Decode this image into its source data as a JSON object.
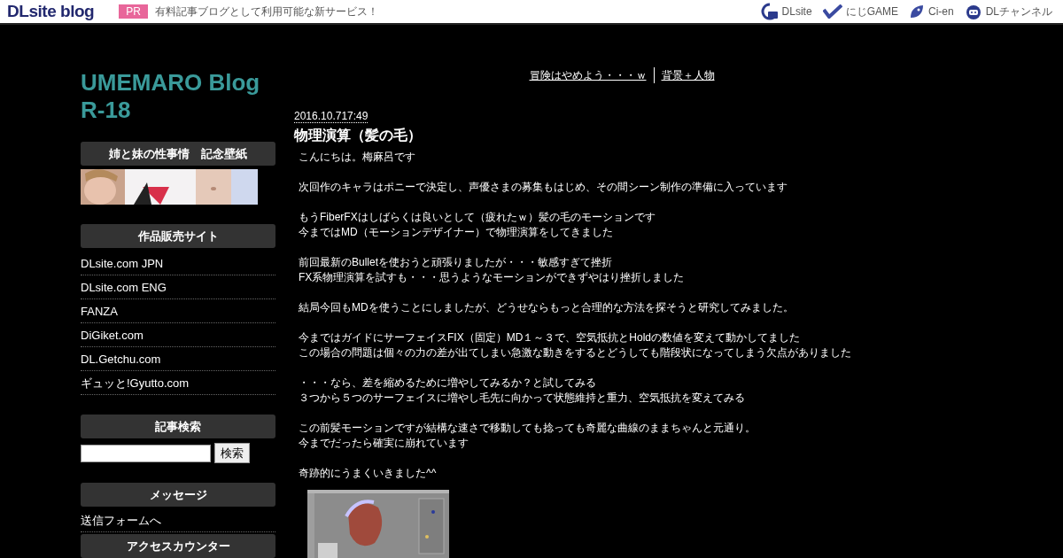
{
  "topbar": {
    "logo": "DLsite blog",
    "pr_badge": "PR",
    "pr_text": "有料記事ブログとして利用可能な新サービス！",
    "links": [
      {
        "label": "DLsite"
      },
      {
        "label": "にじGAME"
      },
      {
        "label": "Ci-en"
      },
      {
        "label": "DLチャンネル"
      }
    ]
  },
  "blog": {
    "title": "UMEMARO Blog R-18"
  },
  "sidebar": [
    {
      "kind": "banner",
      "heading": "姉と妹の性事情　記念壁紙"
    },
    {
      "kind": "links",
      "heading": "作品販売サイト",
      "items": [
        "DLsite.com JPN",
        "DLsite.com ENG",
        "FANZA",
        "DiGiket.com",
        "DL.Getchu.com",
        "ギュッと!Gyutto.com"
      ]
    },
    {
      "kind": "search",
      "heading": "記事検索",
      "button": "検索"
    },
    {
      "kind": "links",
      "heading": "メッセージ",
      "items": [
        "送信フォームへ"
      ]
    },
    {
      "kind": "heading",
      "heading": "アクセスカウンター"
    }
  ],
  "nav": {
    "prev": "冒険はやめよう・・・ｗ",
    "next": "背景＋人物"
  },
  "post": {
    "date": "2016.10.717:49",
    "title": "物理演算（髪の毛）",
    "paragraphs": [
      [
        "こんにちは。梅麻呂です"
      ],
      [
        "次回作のキャラはポニーで決定し、声優さまの募集もはじめ、その間シーン制作の準備に入っています"
      ],
      [
        "もうFiberFXはしばらくは良いとして（疲れたｗ）髪の毛のモーションです",
        "今まではMD（モーションデザイナー）で物理演算をしてきました"
      ],
      [
        "前回最新のBulletを使おうと頑張りましたが・・・敏感すぎて挫折",
        "FX系物理演算を試すも・・・思うようなモーションができずやはり挫折しました"
      ],
      [
        "結局今回もMDを使うことにしましたが、どうせならもっと合理的な方法を探そうと研究してみました。"
      ],
      [
        "今まではガイドにサーフェイスFIX（固定）MD１～３で、空気抵抗とHoldの数値を変えて動かしてました",
        "この場合の問題は個々の力の差が出てしまい急激な動きをするとどうしても階段状になってしまう欠点がありました"
      ],
      [
        "・・・なら、差を縮めるために増やしてみるか？と試してみる",
        "３つから５つのサーフェイスに増やし毛先に向かって状態維持と重力、空気抵抗を変えてみる"
      ],
      [
        "この前髪モーションですが結構な速さで移動しても捻っても奇麗な曲線のままちゃんと元通り。",
        "今までだったら確実に崩れています"
      ],
      [
        "奇跡的にうまくいきました^^"
      ]
    ]
  }
}
